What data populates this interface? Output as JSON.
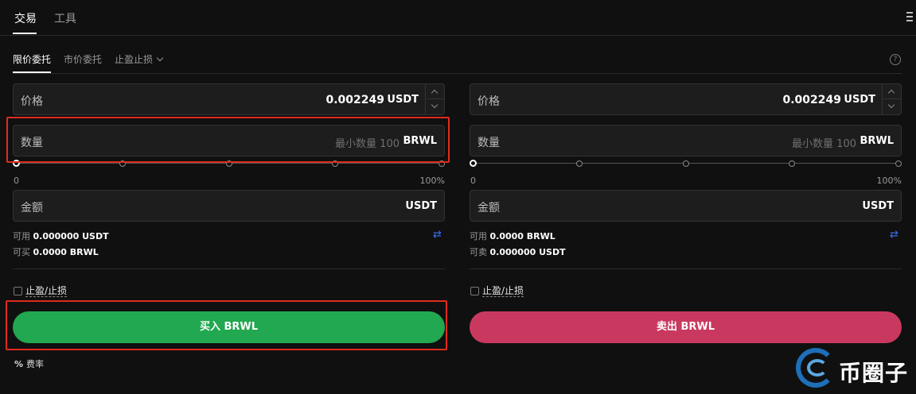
{
  "top_tabs": {
    "trade": "交易",
    "tools": "工具"
  },
  "order_tabs": {
    "limit": "限价委托",
    "market": "市价委托",
    "tpsl": "止盈止损"
  },
  "help_icon": "?",
  "buy_panel": {
    "price": {
      "label": "价格",
      "value": "0.002249",
      "unit": "USDT"
    },
    "quantity": {
      "label": "数量",
      "placeholder": "最小数量 100",
      "unit": "BRWL"
    },
    "slider": {
      "min_label": "0",
      "max_label": "100%",
      "value_percent": 0
    },
    "amount": {
      "label": "金额",
      "unit": "USDT"
    },
    "available": {
      "label": "可用",
      "value": "0.000000 USDT"
    },
    "can_trade": {
      "label": "可买",
      "value": "0.0000 BRWL"
    },
    "tpsl_label": "止盈/止损",
    "button": "买入 BRWL",
    "fee_icon": "%",
    "fee_label": "费率"
  },
  "sell_panel": {
    "price": {
      "label": "价格",
      "value": "0.002249",
      "unit": "USDT"
    },
    "quantity": {
      "label": "数量",
      "placeholder": "最小数量 100",
      "unit": "BRWL"
    },
    "slider": {
      "min_label": "0",
      "max_label": "100%",
      "value_percent": 0
    },
    "amount": {
      "label": "金额",
      "unit": "USDT"
    },
    "available": {
      "label": "可用",
      "value": "0.0000 BRWL"
    },
    "can_trade": {
      "label": "可卖",
      "value": "0.000000 USDT"
    },
    "tpsl_label": "止盈/止损",
    "button": "卖出 BRWL"
  },
  "swap_icon": "⇄",
  "watermark": {
    "text": "币圈子"
  },
  "colors": {
    "buy": "#22a850",
    "sell": "#c9395f",
    "highlight": "#e02a1f",
    "link_blue": "#3b6ff5"
  }
}
